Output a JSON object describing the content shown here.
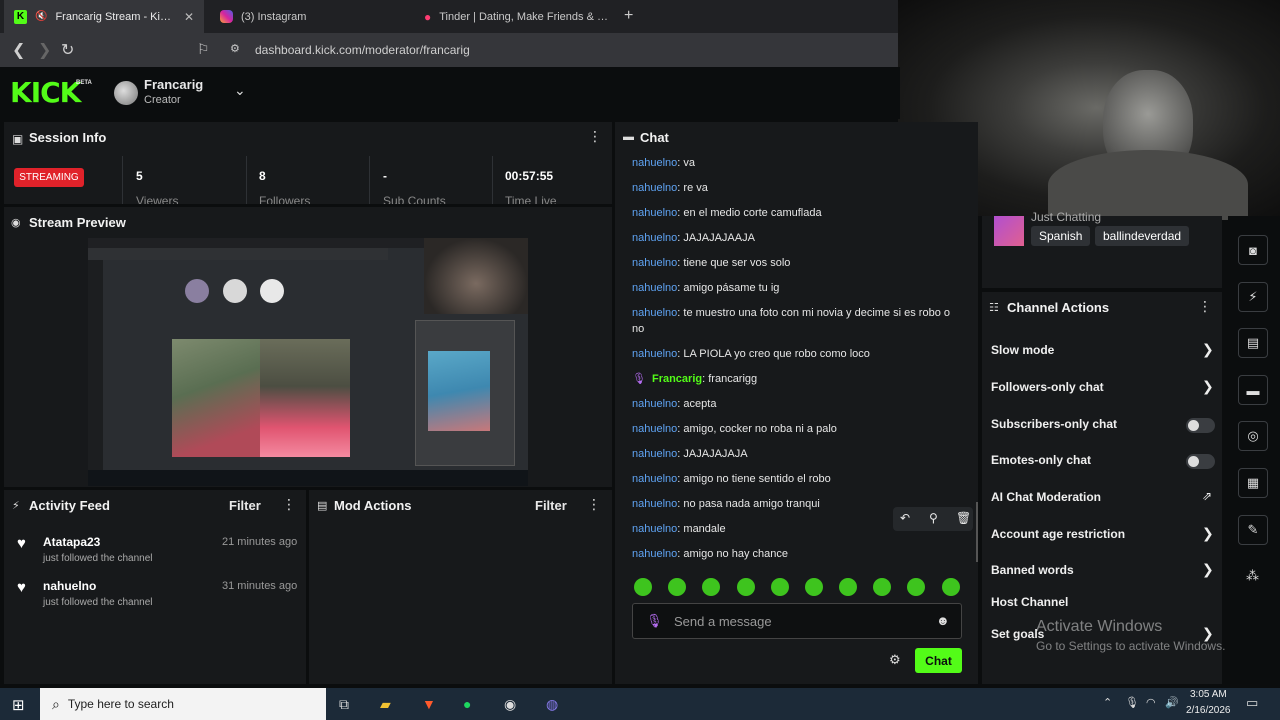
{
  "browser": {
    "tabs": [
      {
        "title": "Francarig Stream - Kick Dasht",
        "active": true
      },
      {
        "title": "(3) Instagram",
        "active": false
      },
      {
        "title": "Tinder | Dating, Make Friends & Meet",
        "active": false
      }
    ],
    "url": "dashboard.kick.com/moderator/francarig"
  },
  "header": {
    "logo": "KICK",
    "beta": "BETA",
    "channel_name": "Francarig",
    "channel_role": "Creator"
  },
  "session": {
    "title": "Session Info",
    "status": "STREAMING",
    "stats": [
      {
        "value": "5",
        "label": "Viewers"
      },
      {
        "value": "8",
        "label": "Followers"
      },
      {
        "value": "-",
        "label": "Sub Counts"
      },
      {
        "value": "00:57:55",
        "label": "Time Live"
      }
    ]
  },
  "preview": {
    "title": "Stream Preview"
  },
  "activity": {
    "title": "Activity Feed",
    "filter": "Filter",
    "items": [
      {
        "name": "Atatapa23",
        "text": "just followed the channel",
        "time": "21 minutes ago"
      },
      {
        "name": "nahuelno",
        "text": "just followed the channel",
        "time": "31 minutes ago"
      }
    ]
  },
  "mod_actions": {
    "title": "Mod Actions",
    "filter": "Filter"
  },
  "chat": {
    "title": "Chat",
    "messages": [
      {
        "user": "nahuelno",
        "text": "va"
      },
      {
        "user": "nahuelno",
        "text": "re va"
      },
      {
        "user": "nahuelno",
        "text": "en el medio corte camuflada"
      },
      {
        "user": "nahuelno",
        "text": "JAJAJAJAAJA"
      },
      {
        "user": "nahuelno",
        "text": "tiene que ser vos solo"
      },
      {
        "user": "nahuelno",
        "text": "amigo pásame tu ig"
      },
      {
        "user": "nahuelno",
        "text": "te muestro una foto con mi novia y decime si es robo o no"
      },
      {
        "user": "nahuelno",
        "text": "LA PIOLA yo creo que robo como loco"
      },
      {
        "user": "Francarig",
        "text": "francarigg"
      },
      {
        "user": "nahuelno",
        "text": "acepta"
      },
      {
        "user": "nahuelno",
        "text": "amigo, cocker no roba ni a palo"
      },
      {
        "user": "nahuelno",
        "text": "JAJAJAJAJA"
      },
      {
        "user": "nahuelno",
        "text": "amigo no tiene sentido el robo"
      },
      {
        "user": "nahuelno",
        "text": "no pasa nada amigo tranqui"
      },
      {
        "user": "nahuelno",
        "text": "mandale"
      },
      {
        "user": "nahuelno",
        "text": "amigo no hay chance"
      }
    ],
    "input_placeholder": "Send a message",
    "send_label": "Chat"
  },
  "stream_info": {
    "category": "Just Chatting",
    "tags": [
      "Spanish",
      "ballindeverdad"
    ]
  },
  "channel_actions": {
    "title": "Channel Actions",
    "items": [
      {
        "label": "Slow mode",
        "control": "chevron"
      },
      {
        "label": "Followers-only chat",
        "control": "chevron"
      },
      {
        "label": "Subscribers-only chat",
        "control": "toggle"
      },
      {
        "label": "Emotes-only chat",
        "control": "toggle"
      },
      {
        "label": "AI Chat Moderation",
        "control": "external"
      },
      {
        "label": "Account age restriction",
        "control": "chevron"
      },
      {
        "label": "Banned words",
        "control": "chevron"
      },
      {
        "label": "Host Channel",
        "control": "none"
      },
      {
        "label": "Set goals",
        "control": "chevron"
      }
    ]
  },
  "watermark": {
    "line1": "Activate Windows",
    "line2": "Go to Settings to activate Windows."
  },
  "taskbar": {
    "search_placeholder": "Type here to search",
    "time": "3:05 AM",
    "date": "2/16/2026"
  },
  "colors": {
    "accent": "#53fc18",
    "username": "#5fa3f3",
    "live": "#e0222a"
  }
}
